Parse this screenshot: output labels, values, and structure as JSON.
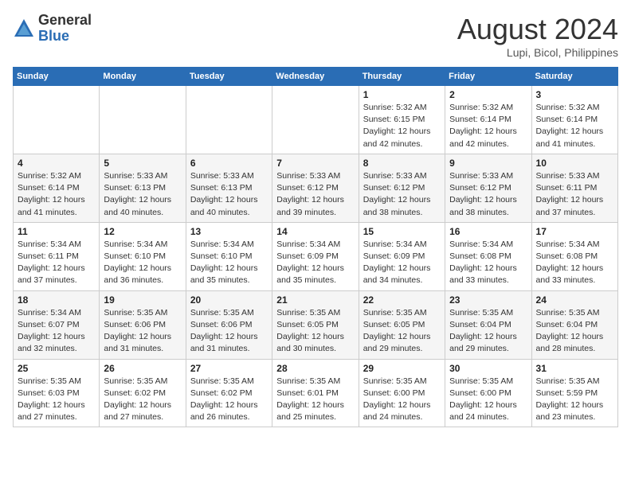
{
  "header": {
    "logo_general": "General",
    "logo_blue": "Blue",
    "month_year": "August 2024",
    "location": "Lupi, Bicol, Philippines"
  },
  "weekdays": [
    "Sunday",
    "Monday",
    "Tuesday",
    "Wednesday",
    "Thursday",
    "Friday",
    "Saturday"
  ],
  "weeks": [
    [
      {
        "day": "",
        "info": ""
      },
      {
        "day": "",
        "info": ""
      },
      {
        "day": "",
        "info": ""
      },
      {
        "day": "",
        "info": ""
      },
      {
        "day": "1",
        "info": "Sunrise: 5:32 AM\nSunset: 6:15 PM\nDaylight: 12 hours and 42 minutes."
      },
      {
        "day": "2",
        "info": "Sunrise: 5:32 AM\nSunset: 6:14 PM\nDaylight: 12 hours and 42 minutes."
      },
      {
        "day": "3",
        "info": "Sunrise: 5:32 AM\nSunset: 6:14 PM\nDaylight: 12 hours and 41 minutes."
      }
    ],
    [
      {
        "day": "4",
        "info": "Sunrise: 5:32 AM\nSunset: 6:14 PM\nDaylight: 12 hours and 41 minutes."
      },
      {
        "day": "5",
        "info": "Sunrise: 5:33 AM\nSunset: 6:13 PM\nDaylight: 12 hours and 40 minutes."
      },
      {
        "day": "6",
        "info": "Sunrise: 5:33 AM\nSunset: 6:13 PM\nDaylight: 12 hours and 40 minutes."
      },
      {
        "day": "7",
        "info": "Sunrise: 5:33 AM\nSunset: 6:12 PM\nDaylight: 12 hours and 39 minutes."
      },
      {
        "day": "8",
        "info": "Sunrise: 5:33 AM\nSunset: 6:12 PM\nDaylight: 12 hours and 38 minutes."
      },
      {
        "day": "9",
        "info": "Sunrise: 5:33 AM\nSunset: 6:12 PM\nDaylight: 12 hours and 38 minutes."
      },
      {
        "day": "10",
        "info": "Sunrise: 5:33 AM\nSunset: 6:11 PM\nDaylight: 12 hours and 37 minutes."
      }
    ],
    [
      {
        "day": "11",
        "info": "Sunrise: 5:34 AM\nSunset: 6:11 PM\nDaylight: 12 hours and 37 minutes."
      },
      {
        "day": "12",
        "info": "Sunrise: 5:34 AM\nSunset: 6:10 PM\nDaylight: 12 hours and 36 minutes."
      },
      {
        "day": "13",
        "info": "Sunrise: 5:34 AM\nSunset: 6:10 PM\nDaylight: 12 hours and 35 minutes."
      },
      {
        "day": "14",
        "info": "Sunrise: 5:34 AM\nSunset: 6:09 PM\nDaylight: 12 hours and 35 minutes."
      },
      {
        "day": "15",
        "info": "Sunrise: 5:34 AM\nSunset: 6:09 PM\nDaylight: 12 hours and 34 minutes."
      },
      {
        "day": "16",
        "info": "Sunrise: 5:34 AM\nSunset: 6:08 PM\nDaylight: 12 hours and 33 minutes."
      },
      {
        "day": "17",
        "info": "Sunrise: 5:34 AM\nSunset: 6:08 PM\nDaylight: 12 hours and 33 minutes."
      }
    ],
    [
      {
        "day": "18",
        "info": "Sunrise: 5:34 AM\nSunset: 6:07 PM\nDaylight: 12 hours and 32 minutes."
      },
      {
        "day": "19",
        "info": "Sunrise: 5:35 AM\nSunset: 6:06 PM\nDaylight: 12 hours and 31 minutes."
      },
      {
        "day": "20",
        "info": "Sunrise: 5:35 AM\nSunset: 6:06 PM\nDaylight: 12 hours and 31 minutes."
      },
      {
        "day": "21",
        "info": "Sunrise: 5:35 AM\nSunset: 6:05 PM\nDaylight: 12 hours and 30 minutes."
      },
      {
        "day": "22",
        "info": "Sunrise: 5:35 AM\nSunset: 6:05 PM\nDaylight: 12 hours and 29 minutes."
      },
      {
        "day": "23",
        "info": "Sunrise: 5:35 AM\nSunset: 6:04 PM\nDaylight: 12 hours and 29 minutes."
      },
      {
        "day": "24",
        "info": "Sunrise: 5:35 AM\nSunset: 6:04 PM\nDaylight: 12 hours and 28 minutes."
      }
    ],
    [
      {
        "day": "25",
        "info": "Sunrise: 5:35 AM\nSunset: 6:03 PM\nDaylight: 12 hours and 27 minutes."
      },
      {
        "day": "26",
        "info": "Sunrise: 5:35 AM\nSunset: 6:02 PM\nDaylight: 12 hours and 27 minutes."
      },
      {
        "day": "27",
        "info": "Sunrise: 5:35 AM\nSunset: 6:02 PM\nDaylight: 12 hours and 26 minutes."
      },
      {
        "day": "28",
        "info": "Sunrise: 5:35 AM\nSunset: 6:01 PM\nDaylight: 12 hours and 25 minutes."
      },
      {
        "day": "29",
        "info": "Sunrise: 5:35 AM\nSunset: 6:00 PM\nDaylight: 12 hours and 24 minutes."
      },
      {
        "day": "30",
        "info": "Sunrise: 5:35 AM\nSunset: 6:00 PM\nDaylight: 12 hours and 24 minutes."
      },
      {
        "day": "31",
        "info": "Sunrise: 5:35 AM\nSunset: 5:59 PM\nDaylight: 12 hours and 23 minutes."
      }
    ]
  ]
}
